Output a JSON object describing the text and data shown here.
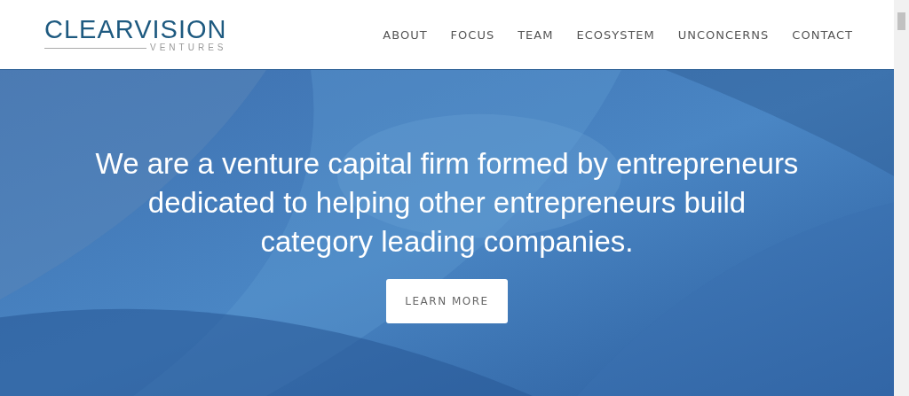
{
  "logo": {
    "name": "CLEARVISION",
    "tagline": "VENTURES"
  },
  "nav": [
    {
      "label": "ABOUT"
    },
    {
      "label": "FOCUS"
    },
    {
      "label": "TEAM"
    },
    {
      "label": "ECOSYSTEM"
    },
    {
      "label": "UNCONCERNS"
    },
    {
      "label": "CONTACT"
    }
  ],
  "hero": {
    "kind": "picture",
    "headline": "We are a venture capital firm formed by entrepreneurs dedicated to helping other entrepreneurs build category leading companies.",
    "button": "LEARN MORE"
  }
}
